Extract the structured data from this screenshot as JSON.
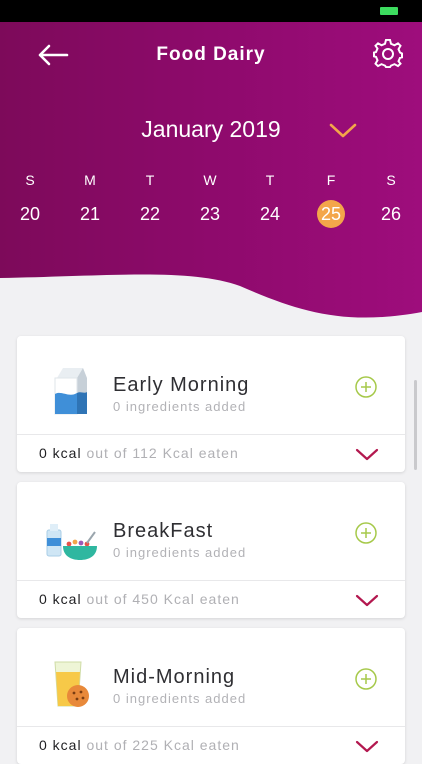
{
  "header": {
    "title": "Food Dairy",
    "month": "January 2019",
    "icons": {
      "back": "arrow-left-icon",
      "settings": "gear-icon",
      "month_toggle": "chevron-down-icon"
    },
    "colors": {
      "gradient_start": "#7d0a5a",
      "gradient_end": "#9e0d7c",
      "selected_day": "#f3a64a"
    }
  },
  "calendar": {
    "days": [
      {
        "dow": "S",
        "num": "20",
        "selected": false
      },
      {
        "dow": "M",
        "num": "21",
        "selected": false
      },
      {
        "dow": "T",
        "num": "22",
        "selected": false
      },
      {
        "dow": "W",
        "num": "23",
        "selected": false
      },
      {
        "dow": "T",
        "num": "24",
        "selected": false
      },
      {
        "dow": "F",
        "num": "25",
        "selected": true
      },
      {
        "dow": "S",
        "num": "26",
        "selected": false
      }
    ]
  },
  "meals": [
    {
      "name": "Early Morning",
      "subtitle": "0 ingredients added",
      "kcal_eaten": "0 kcal",
      "kcal_rest": "out of 112 Kcal eaten",
      "icon": "milk-carton-icon"
    },
    {
      "name": "BreakFast",
      "subtitle": "0 ingredients added",
      "kcal_eaten": "0 kcal",
      "kcal_rest": "out of 450 Kcal eaten",
      "icon": "cereal-bowl-icon"
    },
    {
      "name": "Mid-Morning",
      "subtitle": "0 ingredients added",
      "kcal_eaten": "0 kcal",
      "kcal_rest": "out of 225 Kcal eaten",
      "icon": "juice-cookie-icon"
    }
  ],
  "accents": {
    "add": "#a6c94a",
    "expand": "#b3184f"
  }
}
